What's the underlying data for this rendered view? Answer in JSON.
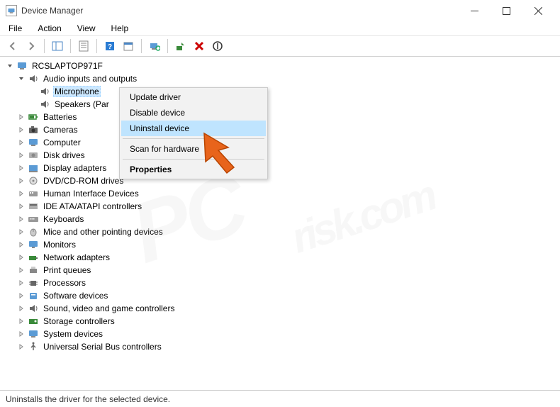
{
  "window": {
    "title": "Device Manager"
  },
  "menu": {
    "file": "File",
    "action": "Action",
    "view": "View",
    "help": "Help"
  },
  "tree": {
    "root": "RCSLAPTOP971F",
    "audio_category": "Audio inputs and outputs",
    "microphone": "Microphone",
    "speakers": "Speakers (Par",
    "categories": [
      "Batteries",
      "Cameras",
      "Computer",
      "Disk drives",
      "Display adapters",
      "DVD/CD-ROM drives",
      "Human Interface Devices",
      "IDE ATA/ATAPI controllers",
      "Keyboards",
      "Mice and other pointing devices",
      "Monitors",
      "Network adapters",
      "Print queues",
      "Processors",
      "Software devices",
      "Sound, video and game controllers",
      "Storage controllers",
      "System devices",
      "Universal Serial Bus controllers"
    ]
  },
  "context_menu": {
    "update_driver": "Update driver",
    "disable_device": "Disable device",
    "uninstall_device": "Uninstall device",
    "scan_hardware": "Scan for hardware",
    "properties": "Properties"
  },
  "status": "Uninstalls the driver for the selected device.",
  "watermark": {
    "main": "PC",
    "sub": "risk.com"
  }
}
